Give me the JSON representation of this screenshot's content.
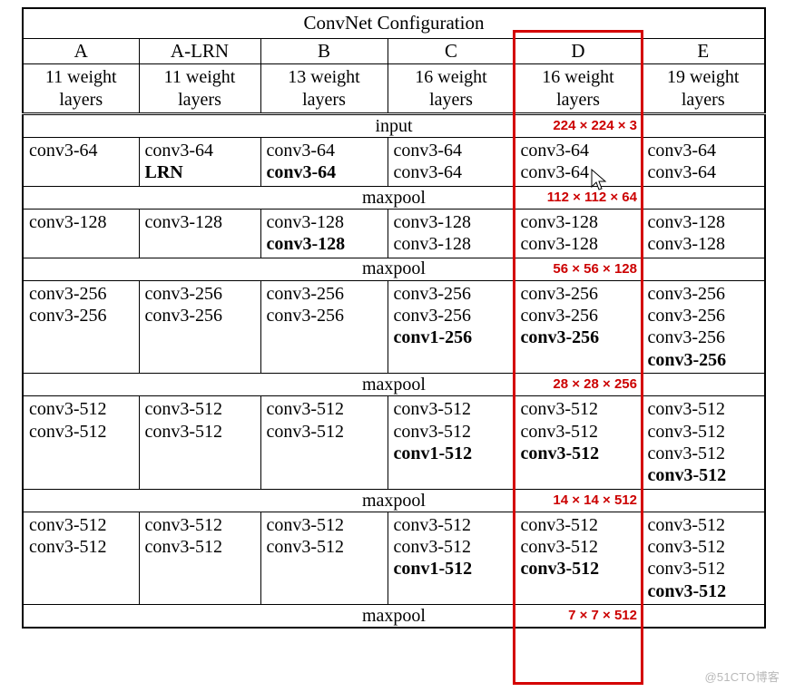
{
  "title": "ConvNet Configuration",
  "columns": [
    "A",
    "A-LRN",
    "B",
    "C",
    "D",
    "E"
  ],
  "descriptions": [
    "11 weight layers",
    "11 weight layers",
    "13 weight layers",
    "16 weight layers",
    "16 weight layers",
    "19 weight layers"
  ],
  "span_rows": {
    "input": {
      "label": "input",
      "anno": "224 × 224 × 3"
    },
    "pool1": {
      "label": "maxpool",
      "anno": "112 × 112 × 64"
    },
    "pool2": {
      "label": "maxpool",
      "anno": "56 × 56 × 128"
    },
    "pool3": {
      "label": "maxpool",
      "anno": "28 × 28 × 256"
    },
    "pool4": {
      "label": "maxpool",
      "anno": "14 × 14 × 512"
    },
    "pool5": {
      "label": "maxpool",
      "anno": "7 × 7 × 512"
    }
  },
  "blocks": {
    "b1": {
      "A": {
        "lines": [
          {
            "t": "conv3-64"
          }
        ]
      },
      "ALRN": {
        "lines": [
          {
            "t": "conv3-64"
          },
          {
            "t": "LRN",
            "b": true
          }
        ]
      },
      "B": {
        "lines": [
          {
            "t": "conv3-64"
          },
          {
            "t": "conv3-64",
            "b": true
          }
        ]
      },
      "C": {
        "lines": [
          {
            "t": "conv3-64"
          },
          {
            "t": "conv3-64"
          }
        ]
      },
      "D": {
        "lines": [
          {
            "t": "conv3-64"
          },
          {
            "t": "conv3-64"
          }
        ]
      },
      "E": {
        "lines": [
          {
            "t": "conv3-64"
          },
          {
            "t": "conv3-64"
          }
        ]
      }
    },
    "b2": {
      "A": {
        "lines": [
          {
            "t": "conv3-128"
          }
        ]
      },
      "ALRN": {
        "lines": [
          {
            "t": "conv3-128"
          }
        ]
      },
      "B": {
        "lines": [
          {
            "t": "conv3-128"
          },
          {
            "t": "conv3-128",
            "b": true
          }
        ]
      },
      "C": {
        "lines": [
          {
            "t": "conv3-128"
          },
          {
            "t": "conv3-128"
          }
        ]
      },
      "D": {
        "lines": [
          {
            "t": "conv3-128"
          },
          {
            "t": "conv3-128"
          }
        ]
      },
      "E": {
        "lines": [
          {
            "t": "conv3-128"
          },
          {
            "t": "conv3-128"
          }
        ]
      }
    },
    "b3": {
      "A": {
        "lines": [
          {
            "t": "conv3-256"
          },
          {
            "t": "conv3-256"
          }
        ]
      },
      "ALRN": {
        "lines": [
          {
            "t": "conv3-256"
          },
          {
            "t": "conv3-256"
          }
        ]
      },
      "B": {
        "lines": [
          {
            "t": "conv3-256"
          },
          {
            "t": "conv3-256"
          }
        ]
      },
      "C": {
        "lines": [
          {
            "t": "conv3-256"
          },
          {
            "t": "conv3-256"
          },
          {
            "t": "conv1-256",
            "b": true
          }
        ]
      },
      "D": {
        "lines": [
          {
            "t": "conv3-256"
          },
          {
            "t": "conv3-256"
          },
          {
            "t": "conv3-256",
            "b": true
          }
        ]
      },
      "E": {
        "lines": [
          {
            "t": "conv3-256"
          },
          {
            "t": "conv3-256"
          },
          {
            "t": "conv3-256"
          },
          {
            "t": "conv3-256",
            "b": true
          }
        ]
      }
    },
    "b4": {
      "A": {
        "lines": [
          {
            "t": "conv3-512"
          },
          {
            "t": "conv3-512"
          }
        ]
      },
      "ALRN": {
        "lines": [
          {
            "t": "conv3-512"
          },
          {
            "t": "conv3-512"
          }
        ]
      },
      "B": {
        "lines": [
          {
            "t": "conv3-512"
          },
          {
            "t": "conv3-512"
          }
        ]
      },
      "C": {
        "lines": [
          {
            "t": "conv3-512"
          },
          {
            "t": "conv3-512"
          },
          {
            "t": "conv1-512",
            "b": true
          }
        ]
      },
      "D": {
        "lines": [
          {
            "t": "conv3-512"
          },
          {
            "t": "conv3-512"
          },
          {
            "t": "conv3-512",
            "b": true
          }
        ]
      },
      "E": {
        "lines": [
          {
            "t": "conv3-512"
          },
          {
            "t": "conv3-512"
          },
          {
            "t": "conv3-512"
          },
          {
            "t": "conv3-512",
            "b": true
          }
        ]
      }
    },
    "b5": {
      "A": {
        "lines": [
          {
            "t": "conv3-512"
          },
          {
            "t": "conv3-512"
          }
        ]
      },
      "ALRN": {
        "lines": [
          {
            "t": "conv3-512"
          },
          {
            "t": "conv3-512"
          }
        ]
      },
      "B": {
        "lines": [
          {
            "t": "conv3-512"
          },
          {
            "t": "conv3-512"
          }
        ]
      },
      "C": {
        "lines": [
          {
            "t": "conv3-512"
          },
          {
            "t": "conv3-512"
          },
          {
            "t": "conv1-512",
            "b": true
          }
        ]
      },
      "D": {
        "lines": [
          {
            "t": "conv3-512"
          },
          {
            "t": "conv3-512"
          },
          {
            "t": "conv3-512",
            "b": true
          }
        ]
      },
      "E": {
        "lines": [
          {
            "t": "conv3-512"
          },
          {
            "t": "conv3-512"
          },
          {
            "t": "conv3-512"
          },
          {
            "t": "conv3-512",
            "b": true
          }
        ]
      }
    }
  },
  "watermark": "@51CTO博客",
  "highlight_column": "D"
}
